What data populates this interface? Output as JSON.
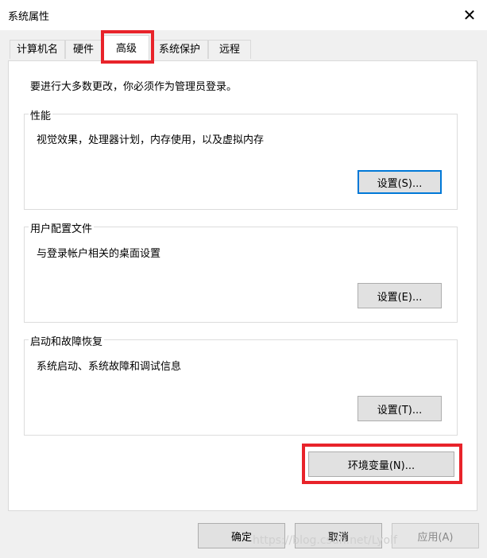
{
  "window": {
    "title": "系统属性",
    "close_glyph": "✕"
  },
  "tabs": [
    "计算机名",
    "硬件",
    "高级",
    "系统保护",
    "远程"
  ],
  "admin_note": "要进行大多数更改，你必须作为管理员登录。",
  "groups": [
    {
      "label": "性能",
      "description": "视觉效果，处理器计划，内存使用，以及虚拟内存",
      "button": "设置(S)..."
    },
    {
      "label": "用户配置文件",
      "description": "与登录帐户相关的桌面设置",
      "button": "设置(E)..."
    },
    {
      "label": "启动和故障恢复",
      "description": "系统启动、系统故障和调试信息",
      "button": "设置(T)..."
    }
  ],
  "env_button": "环境变量(N)...",
  "footer": {
    "ok": "确定",
    "cancel": "取消",
    "apply": "应用(A)"
  },
  "watermark": "https://blog.csdn.net/Lyolf",
  "colors": {
    "highlight_red": "#e8232a",
    "focus_blue": "#0078d7"
  }
}
